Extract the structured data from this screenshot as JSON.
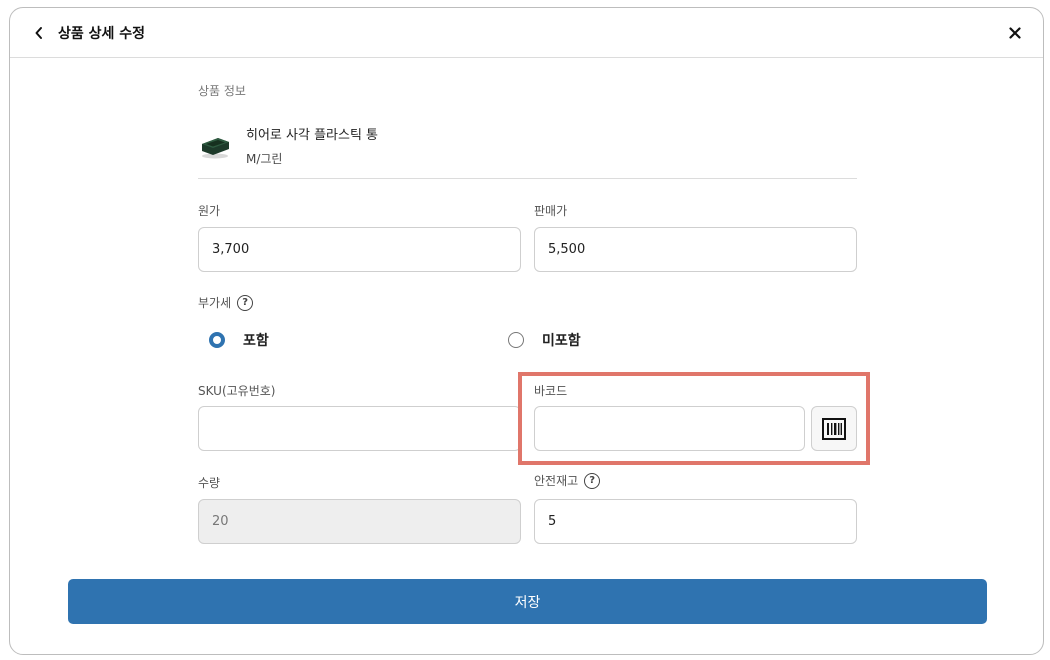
{
  "header": {
    "title": "상품 상세 수정",
    "back_icon": "chevron-left-icon",
    "close_icon": "close-icon"
  },
  "product": {
    "section_label": "상품 정보",
    "name": "히어로 사각 플라스틱 통",
    "option": "M/그린"
  },
  "fields": {
    "cost_label": "원가",
    "cost_value": "3,700",
    "price_label": "판매가",
    "price_value": "5,500",
    "vat_label": "부가세",
    "vat_options": [
      {
        "label": "포함",
        "checked": true
      },
      {
        "label": "미포함",
        "checked": false
      }
    ],
    "sku_label": "SKU(고유번호)",
    "sku_value": "",
    "barcode_label": "바코드",
    "barcode_value": "",
    "quantity_label": "수량",
    "quantity_value": "20",
    "safety_stock_label": "안전재고",
    "safety_stock_value": "5"
  },
  "actions": {
    "save_label": "저장"
  },
  "colors": {
    "accent": "#2f73b0",
    "highlight": "#e0766a"
  }
}
